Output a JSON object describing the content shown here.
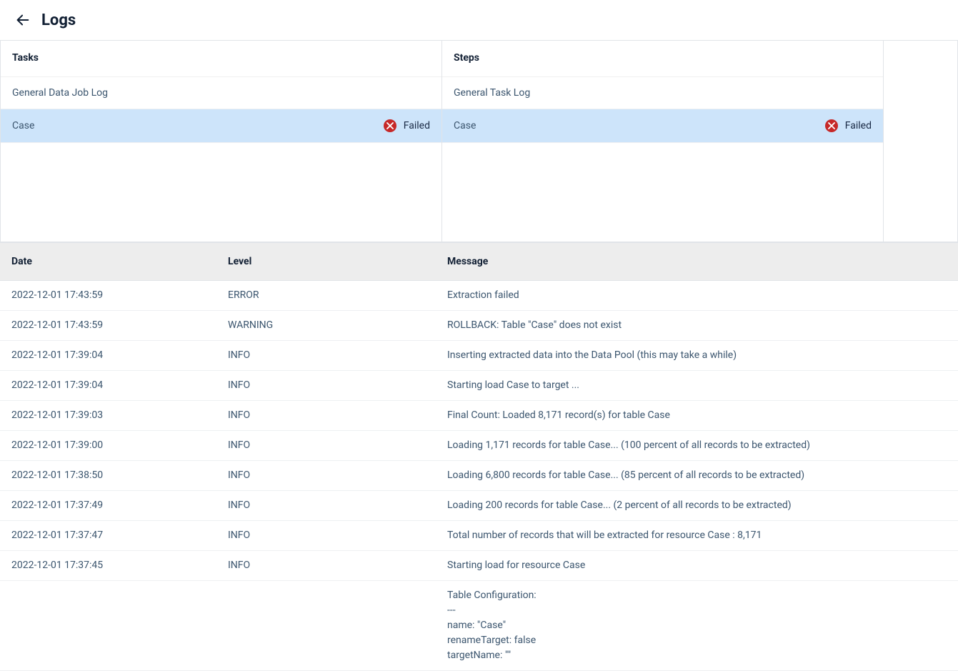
{
  "header": {
    "title": "Logs"
  },
  "panes": {
    "tasks": {
      "title": "Tasks",
      "items": [
        {
          "label": "General Data Job Log",
          "status": null,
          "selected": false
        },
        {
          "label": "Case",
          "status": "Failed",
          "selected": true
        }
      ]
    },
    "steps": {
      "title": "Steps",
      "items": [
        {
          "label": "General Task Log",
          "status": null,
          "selected": false
        },
        {
          "label": "Case",
          "status": "Failed",
          "selected": true
        }
      ]
    }
  },
  "logtable": {
    "columns": {
      "date": "Date",
      "level": "Level",
      "message": "Message"
    },
    "rows": [
      {
        "date": "2022-12-01 17:43:59",
        "level": "ERROR",
        "message": "Extraction failed"
      },
      {
        "date": "2022-12-01 17:43:59",
        "level": "WARNING",
        "message": "ROLLBACK: Table \"Case\" does not exist"
      },
      {
        "date": "2022-12-01 17:39:04",
        "level": "INFO",
        "message": "Inserting extracted data into the Data Pool (this may take a while)"
      },
      {
        "date": "2022-12-01 17:39:04",
        "level": "INFO",
        "message": "Starting load Case to target ..."
      },
      {
        "date": "2022-12-01 17:39:03",
        "level": "INFO",
        "message": "Final Count: Loaded 8,171 record(s) for table Case"
      },
      {
        "date": "2022-12-01 17:39:00",
        "level": "INFO",
        "message": "Loading 1,171 records for table Case... (100 percent of all records to be extracted)"
      },
      {
        "date": "2022-12-01 17:38:50",
        "level": "INFO",
        "message": "Loading 6,800 records for table Case... (85 percent of all records to be extracted)"
      },
      {
        "date": "2022-12-01 17:37:49",
        "level": "INFO",
        "message": "Loading 200 records for table Case... (2 percent of all records to be extracted)"
      },
      {
        "date": "2022-12-01 17:37:47",
        "level": "INFO",
        "message": "Total number of records that will be extracted for resource Case : 8,171"
      },
      {
        "date": "2022-12-01 17:37:45",
        "level": "INFO",
        "message": "Starting load for resource Case"
      },
      {
        "date": "",
        "level": "",
        "message": "Table Configuration:\n---\nname: \"Case\"\nrenameTarget: false\ntargetName: \"\""
      }
    ]
  }
}
